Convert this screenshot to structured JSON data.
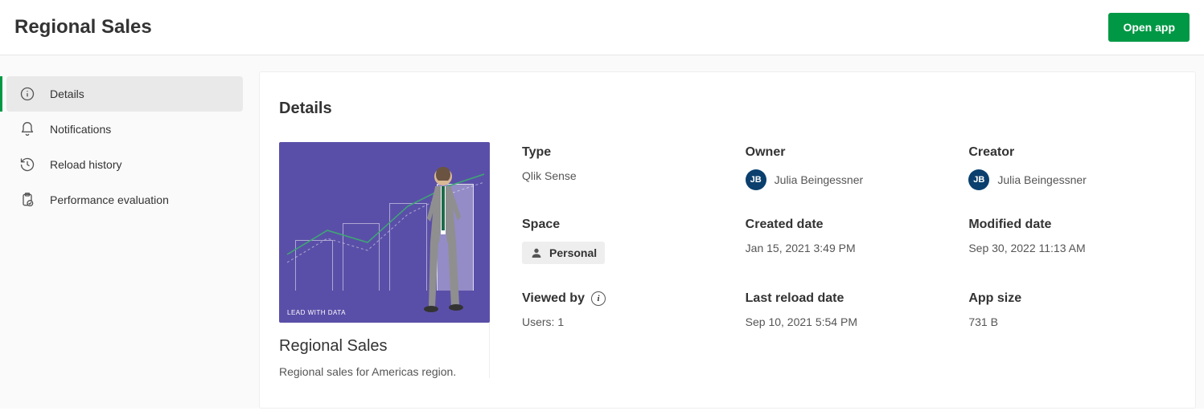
{
  "header": {
    "title": "Regional Sales",
    "open_button": "Open app"
  },
  "sidebar": {
    "items": [
      {
        "label": "Details"
      },
      {
        "label": "Notifications"
      },
      {
        "label": "Reload history"
      },
      {
        "label": "Performance evaluation"
      }
    ]
  },
  "content": {
    "heading": "Details",
    "thumb": {
      "title": "Regional Sales",
      "desc": "Regional sales for Americas region.",
      "banner_text": "LEAD WITH DATA"
    },
    "meta": {
      "type_label": "Type",
      "type_value": "Qlik Sense",
      "owner_label": "Owner",
      "owner_initials": "JB",
      "owner_name": "Julia Beingessner",
      "creator_label": "Creator",
      "creator_initials": "JB",
      "creator_name": "Julia Beingessner",
      "space_label": "Space",
      "space_value": "Personal",
      "created_label": "Created date",
      "created_value": "Jan 15, 2021 3:49 PM",
      "modified_label": "Modified date",
      "modified_value": "Sep 30, 2022 11:13 AM",
      "viewed_label": "Viewed by",
      "viewed_value": "Users: 1",
      "reload_label": "Last reload date",
      "reload_value": "Sep 10, 2021 5:54 PM",
      "size_label": "App size",
      "size_value": "731 B"
    }
  }
}
